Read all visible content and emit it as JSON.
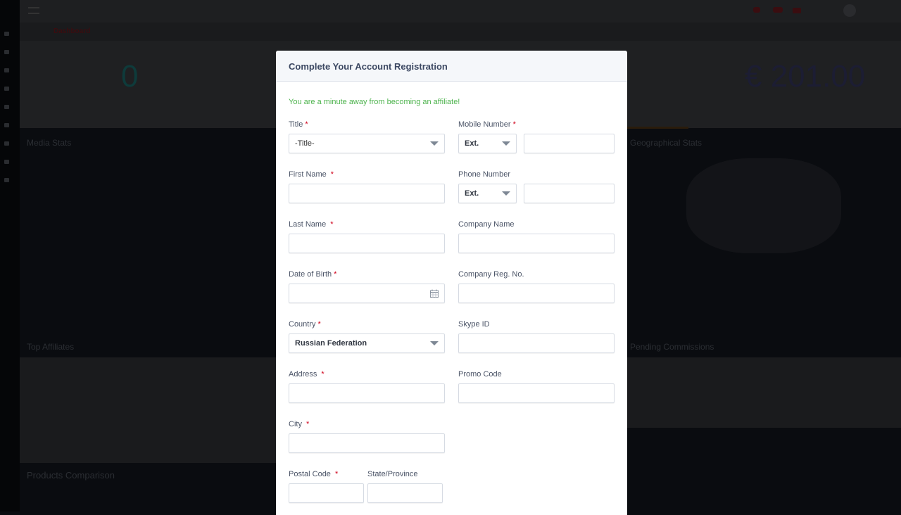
{
  "background": {
    "breadcrumb": "Dashboard",
    "stat_left": "0",
    "stat_right": "€ 201.00",
    "sections": [
      "Media Stats",
      "Geographical Stats",
      "Top Affiliates",
      "Pending Commissions",
      "Products Comparison"
    ]
  },
  "modal": {
    "title": "Complete Your Account Registration",
    "intro": "You are a minute away from becoming an affiliate!",
    "required_mark": "*",
    "fields": {
      "title": {
        "label": "Title",
        "value": "-Title-"
      },
      "mobile": {
        "label": "Mobile Number",
        "ext": "Ext.",
        "value": ""
      },
      "first_name": {
        "label": "First Name",
        "value": ""
      },
      "phone": {
        "label": "Phone Number",
        "ext": "Ext.",
        "value": ""
      },
      "last_name": {
        "label": "Last Name",
        "value": ""
      },
      "company_name": {
        "label": "Company Name",
        "value": ""
      },
      "dob": {
        "label": "Date of Birth",
        "value": ""
      },
      "company_reg": {
        "label": "Company Reg. No.",
        "value": ""
      },
      "country": {
        "label": "Country",
        "value": "Russian Federation"
      },
      "skype": {
        "label": "Skype ID",
        "value": ""
      },
      "address": {
        "label": "Address",
        "value": ""
      },
      "promo": {
        "label": "Promo Code",
        "value": ""
      },
      "city": {
        "label": "City",
        "value": ""
      },
      "postal": {
        "label": "Postal Code",
        "value": ""
      },
      "state": {
        "label": "State/Province",
        "value": ""
      }
    }
  },
  "colors": {
    "accent_green": "#4db34d",
    "required": "#d0021b"
  }
}
